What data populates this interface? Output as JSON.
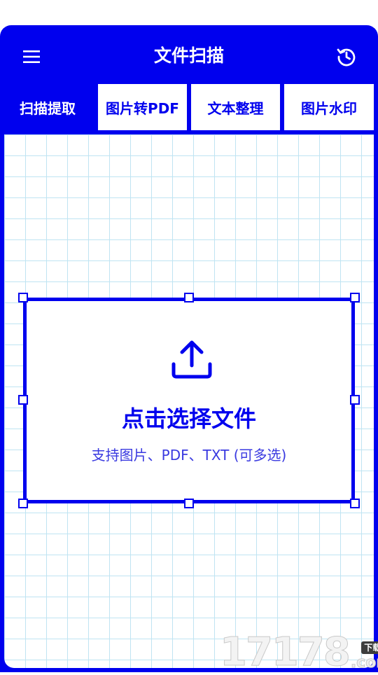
{
  "header": {
    "title": "文件扫描"
  },
  "tabs": [
    {
      "label": "扫描提取",
      "active": true
    },
    {
      "label": "图片转PDF",
      "active": false
    },
    {
      "label": "文本整理",
      "active": false
    },
    {
      "label": "图片水印",
      "active": false
    }
  ],
  "dropzone": {
    "title": "点击选择文件",
    "subtitle": "支持图片、PDF、TXT (可多选)"
  },
  "watermark": {
    "number": "17178",
    "badge": "下载站",
    "suffix": ".com"
  },
  "icons": {
    "menu": "menu-icon",
    "history": "history-icon",
    "upload": "upload-icon"
  },
  "colors": {
    "primary": "#0000ee",
    "grid": "#bfe4f2",
    "subtitle": "#3a3ae0"
  }
}
